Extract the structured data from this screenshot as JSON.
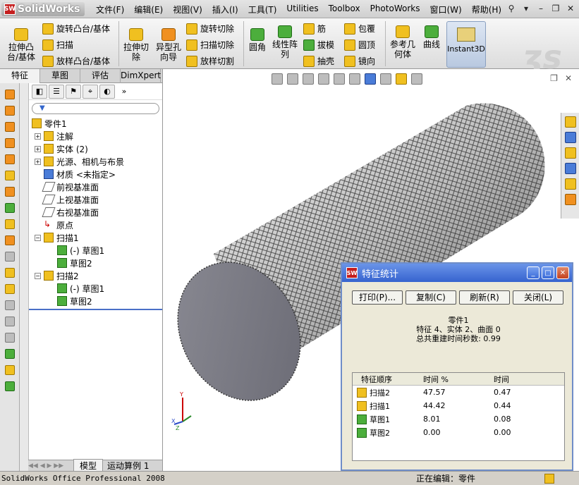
{
  "app": {
    "logo": "SolidWorks",
    "logo_badge": "SW"
  },
  "menu": [
    "文件(F)",
    "编辑(E)",
    "视图(V)",
    "插入(I)",
    "工具(T)",
    "Utilities",
    "Toolbox",
    "PhotoWorks",
    "窗口(W)",
    "帮助(H)"
  ],
  "toolbar": {
    "extrude_boss": "拉伸凸台/基体",
    "revolve_boss": "旋转凸台/基体",
    "sweep": "扫描",
    "loft_boss": "放样凸台/基体",
    "extrude_cut": "拉伸切除",
    "hole_wizard": "异型孔向导",
    "revolve_cut": "旋转切除",
    "sweep_cut": "扫描切除",
    "loft_cut": "放样切割",
    "fillet": "圆角",
    "linear_pattern": "线性阵列",
    "rib": "筋",
    "draft": "拔模",
    "shell": "抽壳",
    "wrap": "包覆",
    "dome": "圆顶",
    "mirror": "镜向",
    "ref_geometry": "参考几何体",
    "curves": "曲线",
    "instant3d": "Instant3D"
  },
  "tabs": [
    "特征",
    "草图",
    "评估",
    "DimXpert"
  ],
  "tree": {
    "root": "零件1",
    "items": [
      {
        "label": "注解",
        "expandable": true
      },
      {
        "label": "实体 (2)",
        "expandable": true
      },
      {
        "label": "光源、相机与布景",
        "expandable": true
      },
      {
        "label": "材质 <未指定>",
        "expandable": false
      },
      {
        "label": "前视基准面",
        "expandable": false
      },
      {
        "label": "上视基准面",
        "expandable": false
      },
      {
        "label": "右视基准面",
        "expandable": false
      },
      {
        "label": "原点",
        "expandable": false
      },
      {
        "label": "扫描1",
        "expandable": true,
        "children": [
          "(-) 草图1",
          "草图2"
        ]
      },
      {
        "label": "扫描2",
        "expandable": true,
        "children": [
          "(-) 草图1",
          "草图2"
        ]
      }
    ]
  },
  "bottom_tabs": [
    "模型",
    "运动算例 1"
  ],
  "dialog": {
    "title": "特征统计",
    "badge": "SW",
    "buttons": [
      "打印(P)...",
      "复制(C)",
      "刷新(R)",
      "关闭(L)"
    ],
    "part": "零件1",
    "counts": "特征 4、实体 2、曲面 0",
    "rebuild": "总共重建时间秒数: 0.99",
    "columns": [
      "特征顺序",
      "时间 %",
      "时间"
    ],
    "rows": [
      {
        "name": "扫描2",
        "pct": "47.57",
        "time": "0.47"
      },
      {
        "name": "扫描1",
        "pct": "44.42",
        "time": "0.44"
      },
      {
        "name": "草图1",
        "pct": "8.01",
        "time": "0.08"
      },
      {
        "name": "草图2",
        "pct": "0.00",
        "time": "0.00"
      }
    ]
  },
  "status": {
    "app": "SolidWorks Office Professional 2008",
    "editing": "正在编辑：零件"
  },
  "triad": {
    "x": "X",
    "y": "Y",
    "z": "Z"
  }
}
